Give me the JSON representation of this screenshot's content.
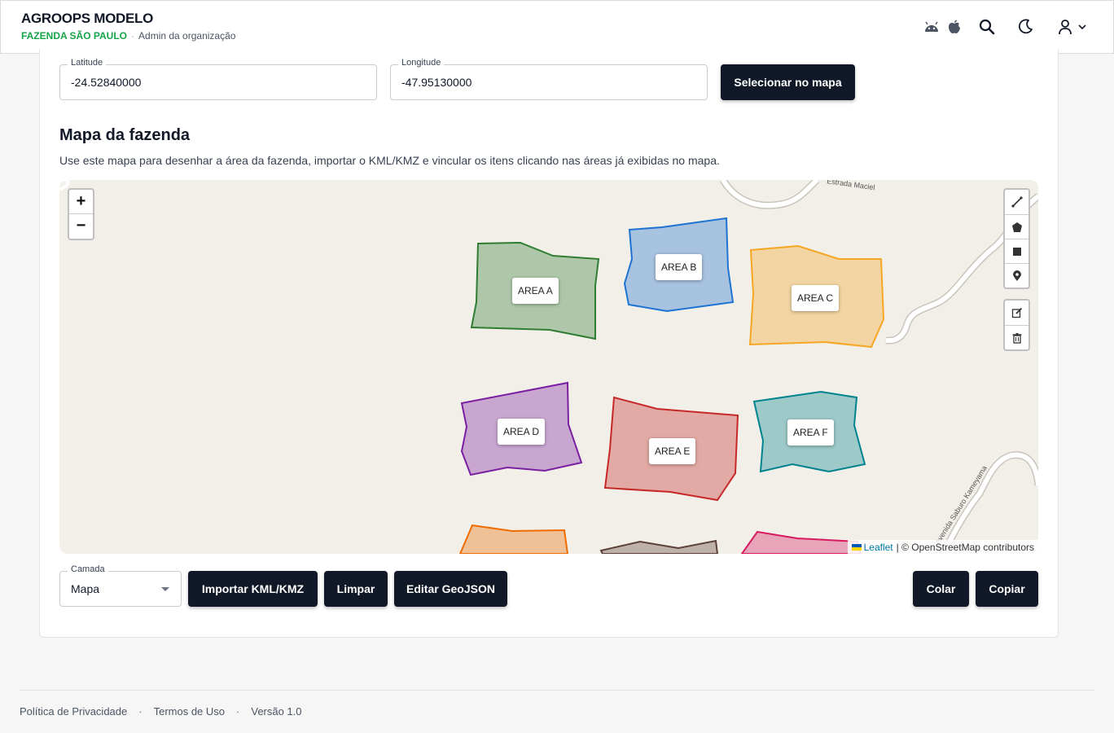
{
  "header": {
    "title": "AGROOPS MODELO",
    "farm": "FAZENDA SÃO PAULO",
    "role": "Admin da organização",
    "icons": [
      "android-icon",
      "apple-icon",
      "search-icon",
      "moon-icon",
      "user-icon",
      "chevron-down-icon"
    ]
  },
  "coords": {
    "latitude_label": "Latitude",
    "latitude_value": "-24.52840000",
    "longitude_label": "Longitude",
    "longitude_value": "-47.95130000",
    "select_button": "Selecionar no mapa"
  },
  "map_section": {
    "title": "Mapa da fazenda",
    "description": "Use este mapa para desenhar a área da fazenda, importar o KML/KMZ e vincular os itens clicando nas áreas já exibidas no mapa."
  },
  "map": {
    "zoom_in": "+",
    "zoom_out": "−",
    "road_labels": [
      "Estrada Maciel",
      "Avenida Saburo Kameyama"
    ],
    "areas": [
      {
        "name": "AREA A",
        "color": "#2e7d32"
      },
      {
        "name": "AREA B",
        "color": "#1e73d2"
      },
      {
        "name": "AREA C",
        "color": "#f5a623"
      },
      {
        "name": "AREA D",
        "color": "#7b1fa2"
      },
      {
        "name": "AREA E",
        "color": "#c62828"
      },
      {
        "name": "AREA F",
        "color": "#00838f"
      }
    ],
    "draw_tools": [
      "polyline-icon",
      "polygon-icon",
      "rectangle-icon",
      "marker-icon"
    ],
    "edit_tools": [
      "edit-icon",
      "trash-icon"
    ],
    "attribution_leaflet": "Leaflet",
    "attribution_rest": "| © OpenStreetMap contributors"
  },
  "controls": {
    "layer_label": "Camada",
    "layer_value": "Mapa",
    "import_button": "Importar KML/KMZ",
    "clear_button": "Limpar",
    "edit_geojson_button": "Editar GeoJSON",
    "paste_button": "Colar",
    "copy_button": "Copiar"
  },
  "footer": {
    "privacy": "Política de Privacidade",
    "terms": "Termos de Uso",
    "version": "Versão 1.0"
  }
}
